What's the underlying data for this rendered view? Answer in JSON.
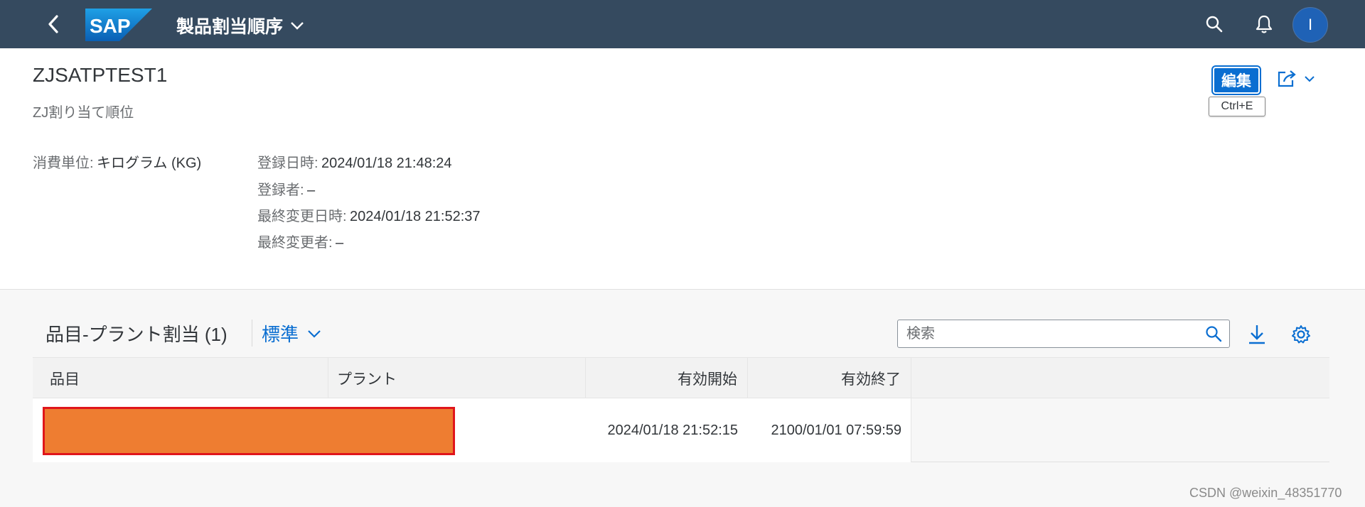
{
  "shell": {
    "logo_text": "SAP",
    "app_title": "製品割当順序",
    "avatar_initial": "I",
    "icons": [
      "back-icon",
      "search-icon",
      "bell-icon",
      "chevron-down-icon"
    ]
  },
  "header": {
    "title": "ZJSATPTEST1",
    "subtitle": "ZJ割り当て順位",
    "edit_label": "編集",
    "edit_tooltip": "Ctrl+E",
    "fields": {
      "unit_label": "消費単位:",
      "unit_value": "キログラム (KG)",
      "created_on_label": "登録日時:",
      "created_on_value": "2024/01/18 21:48:24",
      "created_by_label": "登録者:",
      "created_by_value": "–",
      "changed_on_label": "最終変更日時:",
      "changed_on_value": "2024/01/18 21:52:37",
      "changed_by_label": "最終変更者:",
      "changed_by_value": "–"
    }
  },
  "section": {
    "title": "品目-プラント割当 (1)",
    "variant": "標準",
    "search_placeholder": "検索"
  },
  "table": {
    "columns": [
      "品目",
      "プラント",
      "有効開始",
      "有効終了"
    ],
    "rows": [
      {
        "material": "",
        "plant": "",
        "valid_from": "2024/01/18 21:52:15",
        "valid_to": "2100/01/01 07:59:59"
      }
    ]
  },
  "watermark": "CSDN @weixin_48351770",
  "colors": {
    "shell_bg": "#354a5f",
    "accent": "#0a6ed1",
    "redaction_fill": "#ee7d31",
    "redaction_border": "#e0151b"
  }
}
